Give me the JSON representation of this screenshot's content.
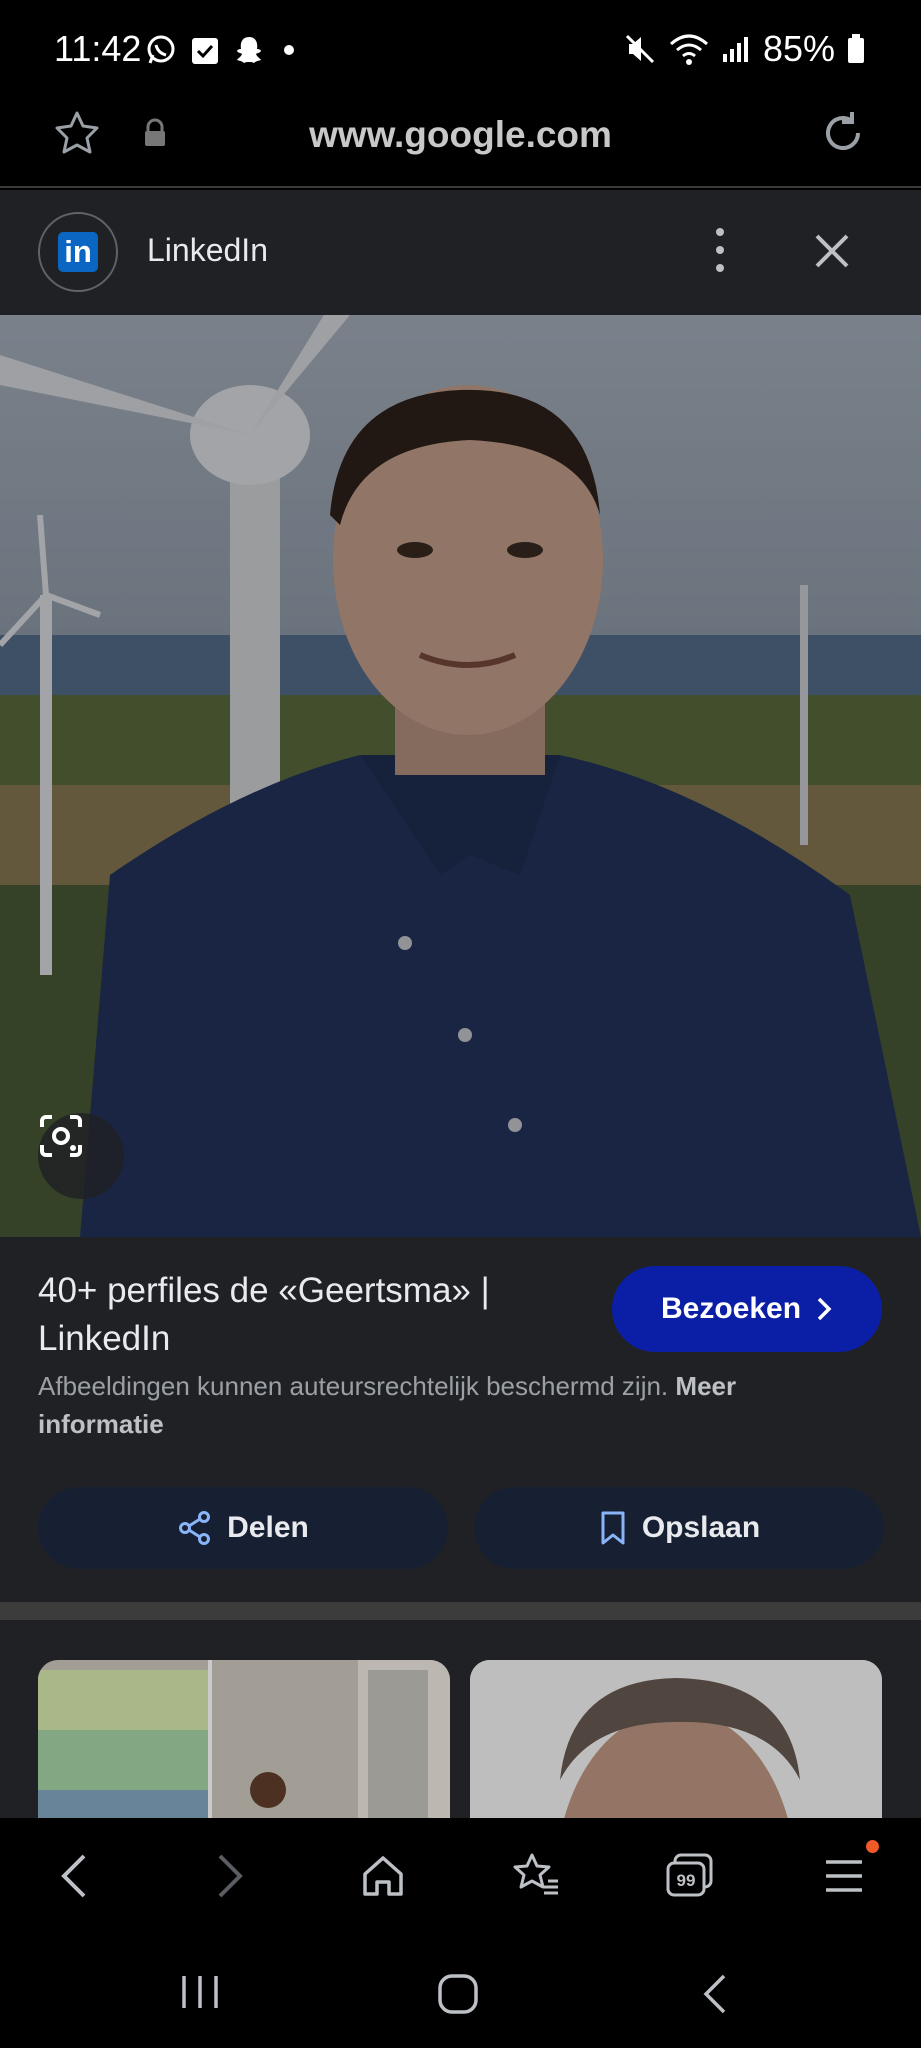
{
  "status_bar": {
    "time": "11:42",
    "battery": "85%",
    "left_icons": [
      "whatsapp-icon",
      "checklist-icon",
      "snapchat-icon",
      "dot-icon"
    ],
    "right_icons": [
      "mute-icon",
      "wifi-icon",
      "signal-icon",
      "battery-icon"
    ]
  },
  "browser": {
    "url": "www.google.com"
  },
  "source": {
    "name": "LinkedIn",
    "logo_text": "in"
  },
  "result": {
    "title": "40+ perfiles de «Geertsma» | LinkedIn",
    "visit_label": "Bezoeken",
    "copyright_text": "Afbeeldingen kunnen auteursrechtelijk beschermd zijn.",
    "more_info_label": "Meer informatie",
    "share_label": "Delen",
    "save_label": "Opslaan"
  },
  "colors": {
    "visit_button": "#0b1fa6",
    "action_button": "#172032",
    "panel": "#202124",
    "accent_icon": "#8ab4f8",
    "notification_dot": "#f05a28"
  },
  "bottom_nav": [
    "back-icon",
    "forward-icon",
    "home-icon",
    "bookmarks-icon",
    "tabs-icon",
    "menu-icon"
  ],
  "tabs_count": "99"
}
